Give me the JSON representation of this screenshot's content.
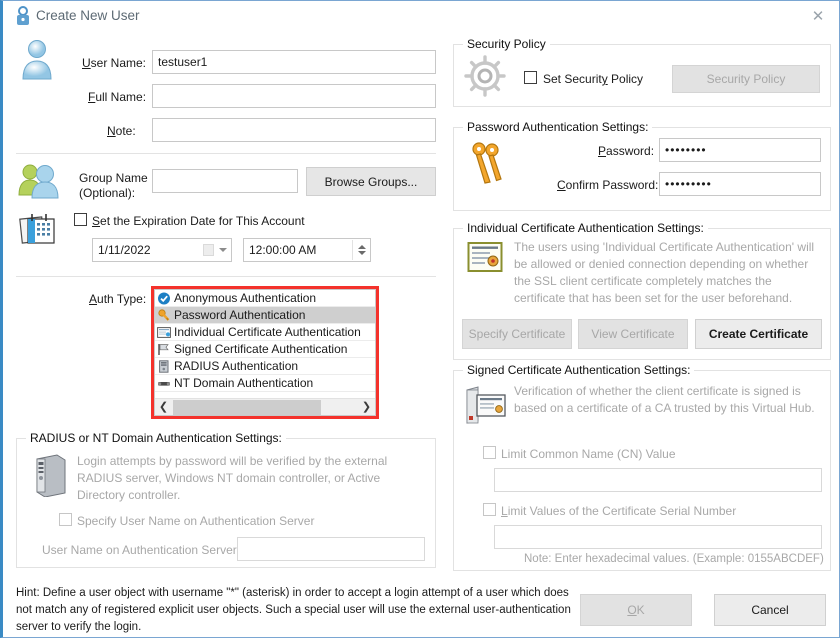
{
  "window": {
    "title": "Create New User",
    "title_icon": "user-lock-icon",
    "close_icon": "close-icon",
    "accent_color": "#3a8ac4"
  },
  "user_info": {
    "icon": "user-icon",
    "user_name_label": "User Name:",
    "user_name_value": "testuser1",
    "full_name_label": "Full Name:",
    "full_name_value": "",
    "note_label": "Note:",
    "note_value": ""
  },
  "group_section": {
    "icon": "group-users-icon",
    "group_name_label_line1": "Group Name",
    "group_name_label_line2": "(Optional):",
    "group_name_value": "",
    "browse_groups_label": "Browse Groups..."
  },
  "expiration": {
    "icon": "calendar-icon",
    "checkbox_label": "Set the Expiration Date for This Account",
    "checked": false,
    "date_value": "1/11/2022",
    "time_value": "12:00:00 AM"
  },
  "auth_type": {
    "label": "Auth Type:",
    "highlight_color": "#f4322c",
    "selected_index": 1,
    "items": [
      {
        "label": "Anonymous Authentication",
        "icon": "check-circle-icon"
      },
      {
        "label": "Password Authentication",
        "icon": "key-icon"
      },
      {
        "label": "Individual Certificate Authentication",
        "icon": "certificate-icon"
      },
      {
        "label": "Signed Certificate Authentication",
        "icon": "flag-certificate-icon"
      },
      {
        "label": "RADIUS Authentication",
        "icon": "server-icon"
      },
      {
        "label": "NT Domain Authentication",
        "icon": "nt-domain-icon"
      }
    ],
    "scroll_left_icon": "chevron-left-icon",
    "scroll_right_icon": "chevron-right-icon"
  },
  "radius_section": {
    "title": "RADIUS or NT Domain Authentication Settings:",
    "icon": "server-tower-icon",
    "description": "Login attempts by password will be verified by the external RADIUS server, Windows NT domain controller, or Active Directory controller.",
    "specify_checkbox_label": "Specify User Name on Authentication Server",
    "specify_checked": false,
    "username_label": "User Name on Authentication Server:",
    "username_value": ""
  },
  "security_policy": {
    "title": "Security Policy",
    "icon": "gear-icon",
    "checkbox_label": "Set Security Policy",
    "checked": false,
    "button_label": "Security Policy",
    "button_enabled": false
  },
  "password_section": {
    "title": "Password Authentication Settings:",
    "icon": "keys-icon",
    "password_label": "Password:",
    "password_value": "••••••••",
    "confirm_label": "Confirm Password:",
    "confirm_value": "•••••••••"
  },
  "individual_cert": {
    "title": "Individual Certificate Authentication Settings:",
    "icon": "certificate-award-icon",
    "description": "The users using 'Individual Certificate Authentication' will be allowed or denied connection depending on whether the SSL client certificate completely matches the certificate that has been set for the user beforehand.",
    "specify_label": "Specify Certificate",
    "specify_enabled": false,
    "view_label": "View Certificate",
    "view_enabled": false,
    "create_label": "Create Certificate",
    "create_enabled": true
  },
  "signed_cert": {
    "title": "Signed Certificate Authentication Settings:",
    "icon": "signed-certificate-icon",
    "description": "Verification of whether the client certificate is signed is based on a certificate of a CA trusted by this Virtual Hub.",
    "cn_checkbox_label": "Limit Common Name (CN) Value",
    "cn_checked": false,
    "cn_value": "",
    "serial_checkbox_label": "Limit Values of the Certificate Serial Number",
    "serial_checked": false,
    "serial_value": "",
    "note": "Note: Enter hexadecimal values. (Example: 0155ABCDEF)"
  },
  "footer": {
    "hint": "Hint: Define a user object with username \"*\" (asterisk) in order to accept a login attempt of a user which does not match any of registered explicit user objects. Such a special user will use the external user-authentication server to verify the login.",
    "ok_label": "OK",
    "ok_enabled": false,
    "cancel_label": "Cancel",
    "cancel_enabled": true
  }
}
